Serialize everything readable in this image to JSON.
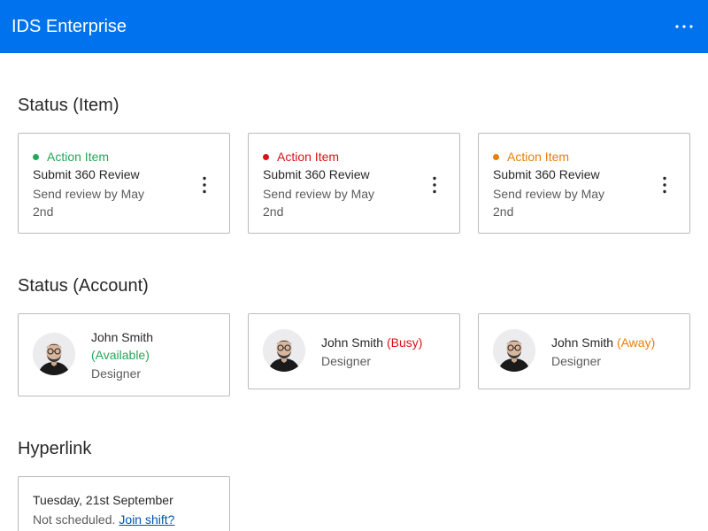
{
  "header": {
    "title": "IDS Enterprise",
    "more_icon": "more-horizontal-icon"
  },
  "sections": {
    "status_item": "Status (Item)",
    "status_account": "Status (Account)",
    "hyperlink": "Hyperlink"
  },
  "item_cards": [
    {
      "status_label": "Action Item",
      "title": "Submit 360 Review",
      "description": "Send review by May 2nd",
      "status_color": "#26a65b"
    },
    {
      "status_label": "Action Item",
      "title": "Submit 360 Review",
      "description": "Send review by May 2nd",
      "status_color": "#da1217"
    },
    {
      "status_label": "Action Item",
      "title": "Submit 360 Review",
      "description": "Send review by May 2nd",
      "status_color": "#e97f06"
    }
  ],
  "account_cards": [
    {
      "name": "John Smith",
      "status": "(Available)",
      "role": "Designer",
      "status_color": "#26a65b"
    },
    {
      "name": "John Smith",
      "status": "(Busy)",
      "role": "Designer",
      "status_color": "#da1217"
    },
    {
      "name": "John Smith",
      "status": "(Away)",
      "role": "Designer",
      "status_color": "#e97f06"
    }
  ],
  "hyperlink_card": {
    "date": "Tuesday, 21st September",
    "text": "Not scheduled.",
    "link": "Join shift?",
    "link_color": "#0054b1"
  }
}
